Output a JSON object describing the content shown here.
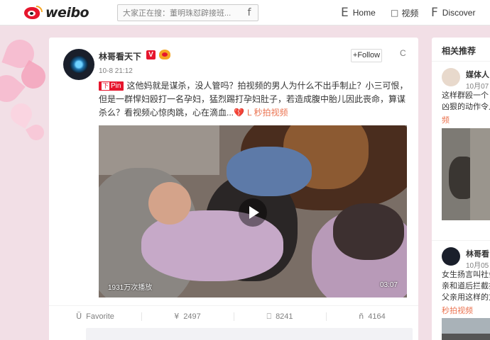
{
  "brand": {
    "logo_text": "weibo",
    "logo_icon": "weibo-eye-logo"
  },
  "search": {
    "placeholder": "大家正在搜：董明珠怼辟接班...",
    "icon": "search-icon",
    "icon_glyph": "f"
  },
  "nav": [
    {
      "icon_glyph": "E",
      "icon": "home-icon",
      "label": "Home"
    },
    {
      "icon_glyph": "□",
      "icon": "video-icon",
      "label": "视频"
    },
    {
      "icon_glyph": "F",
      "icon": "discover-icon",
      "label": "Discover"
    }
  ],
  "post": {
    "username": "林哥看天下",
    "verified_badge": "V",
    "timestamp": "10-8 21:12",
    "follow_label": "+Follow",
    "more_icon": "C",
    "pin_icon_glyph": "下",
    "pin_label": "Pin",
    "text": "这他妈就是谋杀，没人管吗？拍视频的男人为什么不出手制止？小三可恨，但是一群悍妇殴打一名孕妇，猛烈踢打孕妇肚子，若造成腹中胎儿因此丧命，算谋杀么？看视频心惊肉跳，心在滴血...",
    "heart_emoji": "💔",
    "video_link": "L 秒拍视频",
    "video": {
      "views": "1931万次播放",
      "duration": "03:07"
    },
    "actions": [
      {
        "icon": "favorite-icon",
        "glyph": "Ü",
        "label": "Favorite"
      },
      {
        "icon": "repost-icon",
        "glyph": "¥",
        "label": "2497"
      },
      {
        "icon": "comment-icon",
        "glyph": "⎕",
        "label": "8241"
      },
      {
        "icon": "like-icon",
        "glyph": "ñ",
        "label": "4164"
      }
    ]
  },
  "sidebar": {
    "title": "相关推荐",
    "items": [
      {
        "name": "媒体人",
        "time": "10月07",
        "lines": [
          "这样群殴一个",
          "凶狠的动作令人"
        ],
        "link": "频"
      },
      {
        "name": "林哥看",
        "time": "10月05",
        "lines": [
          "女生扬言叫社会",
          "亲和道后拦截打",
          "父亲用这样的方"
        ],
        "link": "秒拍视频"
      }
    ]
  },
  "colors": {
    "accent": "#e6162d",
    "link": "#eb7350",
    "follow_plus": "#ff8140",
    "page_bg": "#f2dfe6"
  }
}
